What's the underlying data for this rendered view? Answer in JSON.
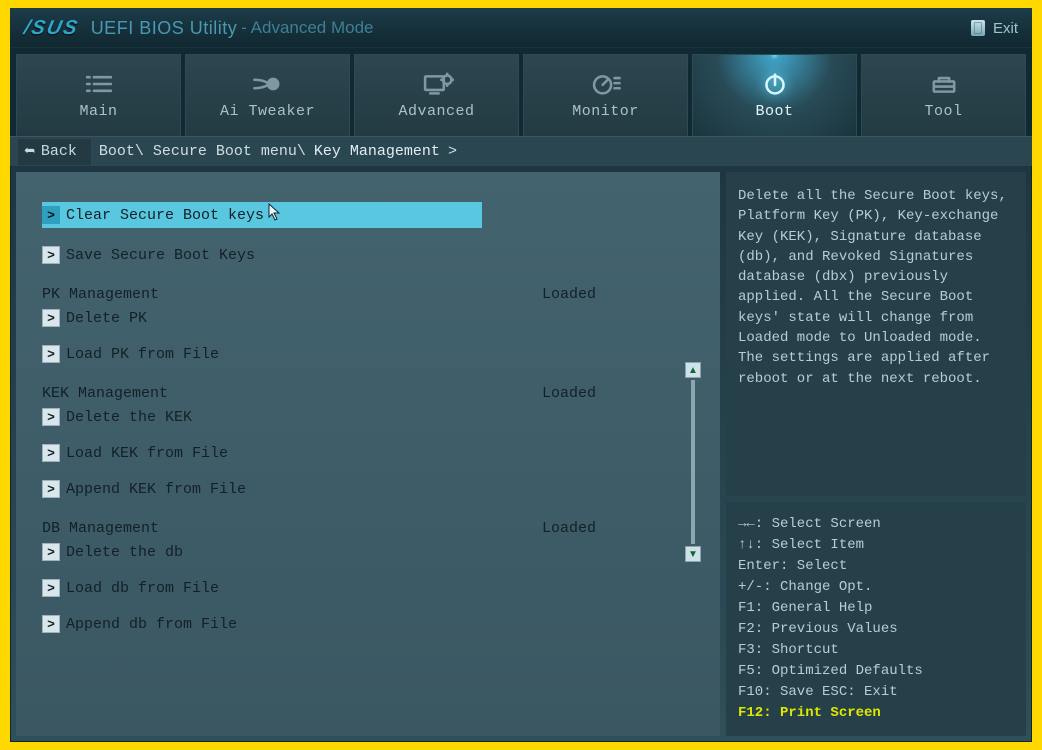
{
  "header": {
    "logo": "/SUS",
    "title": "UEFI BIOS Utility",
    "subtitle": "- Advanced Mode",
    "exit": "Exit"
  },
  "tabs": [
    {
      "id": "main",
      "label": "Main"
    },
    {
      "id": "aitweaker",
      "label": "Ai Tweaker"
    },
    {
      "id": "advanced",
      "label": "Advanced"
    },
    {
      "id": "monitor",
      "label": "Monitor"
    },
    {
      "id": "boot",
      "label": "Boot",
      "active": true
    },
    {
      "id": "tool",
      "label": "Tool"
    }
  ],
  "breadcrumb": {
    "back": "Back",
    "parts": [
      "Boot\\ Secure Boot menu\\",
      "Key Management",
      ">"
    ]
  },
  "left": {
    "items_top": [
      {
        "label": "Clear Secure Boot keys",
        "selected": true
      },
      {
        "label": "Save Secure Boot Keys"
      }
    ],
    "groups": [
      {
        "title": "PK Management",
        "status": "Loaded",
        "items": [
          {
            "label": "Delete PK"
          },
          {
            "label": "Load PK from File"
          }
        ]
      },
      {
        "title": "KEK Management",
        "status": "Loaded",
        "items": [
          {
            "label": "Delete the KEK"
          },
          {
            "label": "Load KEK from File"
          },
          {
            "label": "Append KEK from File"
          }
        ]
      },
      {
        "title": "DB Management",
        "status": "Loaded",
        "items": [
          {
            "label": "Delete the db"
          },
          {
            "label": "Load db from File"
          },
          {
            "label": "Append db from File"
          }
        ]
      }
    ]
  },
  "info": "Delete all the Secure Boot keys, Platform Key (PK), Key-exchange Key (KEK), Signature database (db), and Revoked Signatures database (dbx) previously applied. All the Secure Boot keys' state will change from Loaded mode to Unloaded mode. The settings are applied after reboot or at the next  reboot.",
  "help": {
    "lines": [
      "→←: Select Screen",
      "↑↓: Select Item",
      "Enter: Select",
      "+/-: Change Opt.",
      "F1: General Help",
      "F2: Previous Values",
      "F3: Shortcut",
      "F5: Optimized Defaults",
      "F10: Save  ESC: Exit"
    ],
    "highlight": "F12: Print Screen"
  }
}
